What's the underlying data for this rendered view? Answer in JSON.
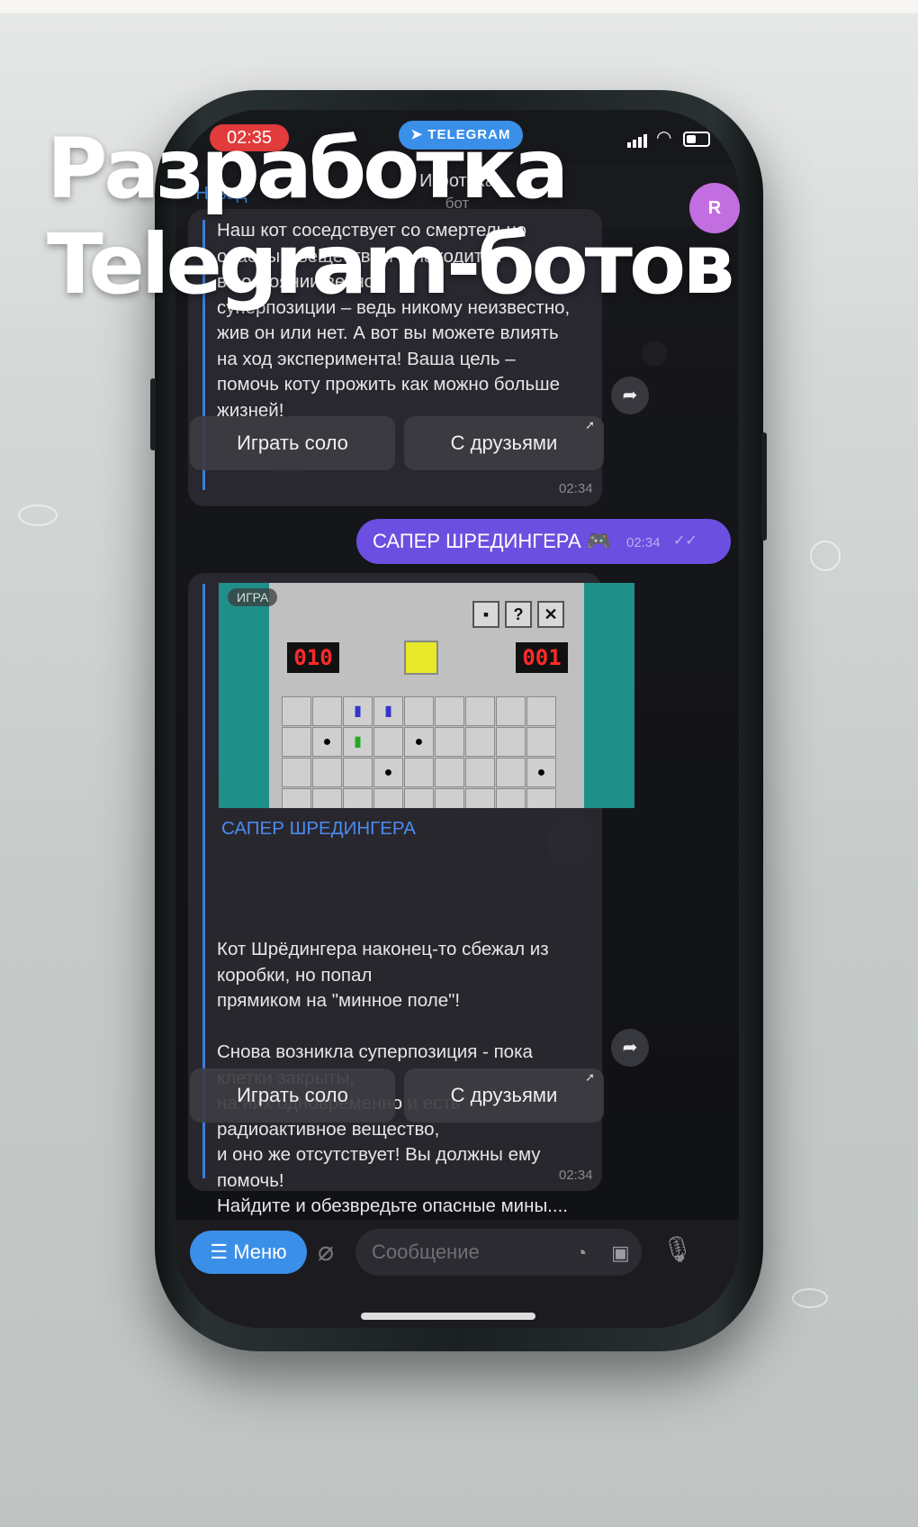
{
  "headline": {
    "line1": "Разработка",
    "line2": "Telegram-ботов"
  },
  "status_bar": {
    "time": "02:35",
    "app_pill": "TELEGRAM"
  },
  "chat_header": {
    "back_label": "Назад",
    "title": "Игротека",
    "subtitle": "бот",
    "avatar_letter": "R"
  },
  "message1": {
    "text": "Наш кот соседствует со смертельно\nопасным веществом и находится\nв состоянии вечной\nсуперпозиции – ведь никому неизвестно,\nжив он или нет. А вот вы можете влиять\nна ход эксперимента! Ваша цель –\nпомочь коту прожить как можно больше\nжизней!",
    "time": "02:34",
    "buttons": [
      "Играть соло",
      "С друзьями"
    ]
  },
  "outgoing": {
    "text": "САПЕР ШРЕДИНГЕРА 🎮",
    "time": "02:34"
  },
  "game_message": {
    "image_tag": "ИГРА",
    "window_buttons": [
      "?",
      "✕"
    ],
    "counter_left": "010",
    "counter_right": "001",
    "title": "САПЕР ШРЕДИНГЕРА",
    "text": "Кот Шрёдингера наконец-то сбежал из\nкоробки, но попал\nпрямиком на \"минное поле\"!\n\nСнова возникла суперпозиция - пока\nклетки закрыты,\nна них одновременно и есть\nрадиоактивное вещество,\nи оно же отсутствует! Вы должны ему\nпомочь!\nНайдите и обезвредьте опасные мины....",
    "time": "02:34",
    "buttons": [
      "Играть соло",
      "С друзьями"
    ]
  },
  "input_bar": {
    "menu_label": "Меню",
    "placeholder": "Сообщение"
  },
  "colors": {
    "accent": "#3a8fe8",
    "outgoing": "#6b4fe0",
    "time_pill": "#e23b3b",
    "avatar": "#c36ee0"
  }
}
